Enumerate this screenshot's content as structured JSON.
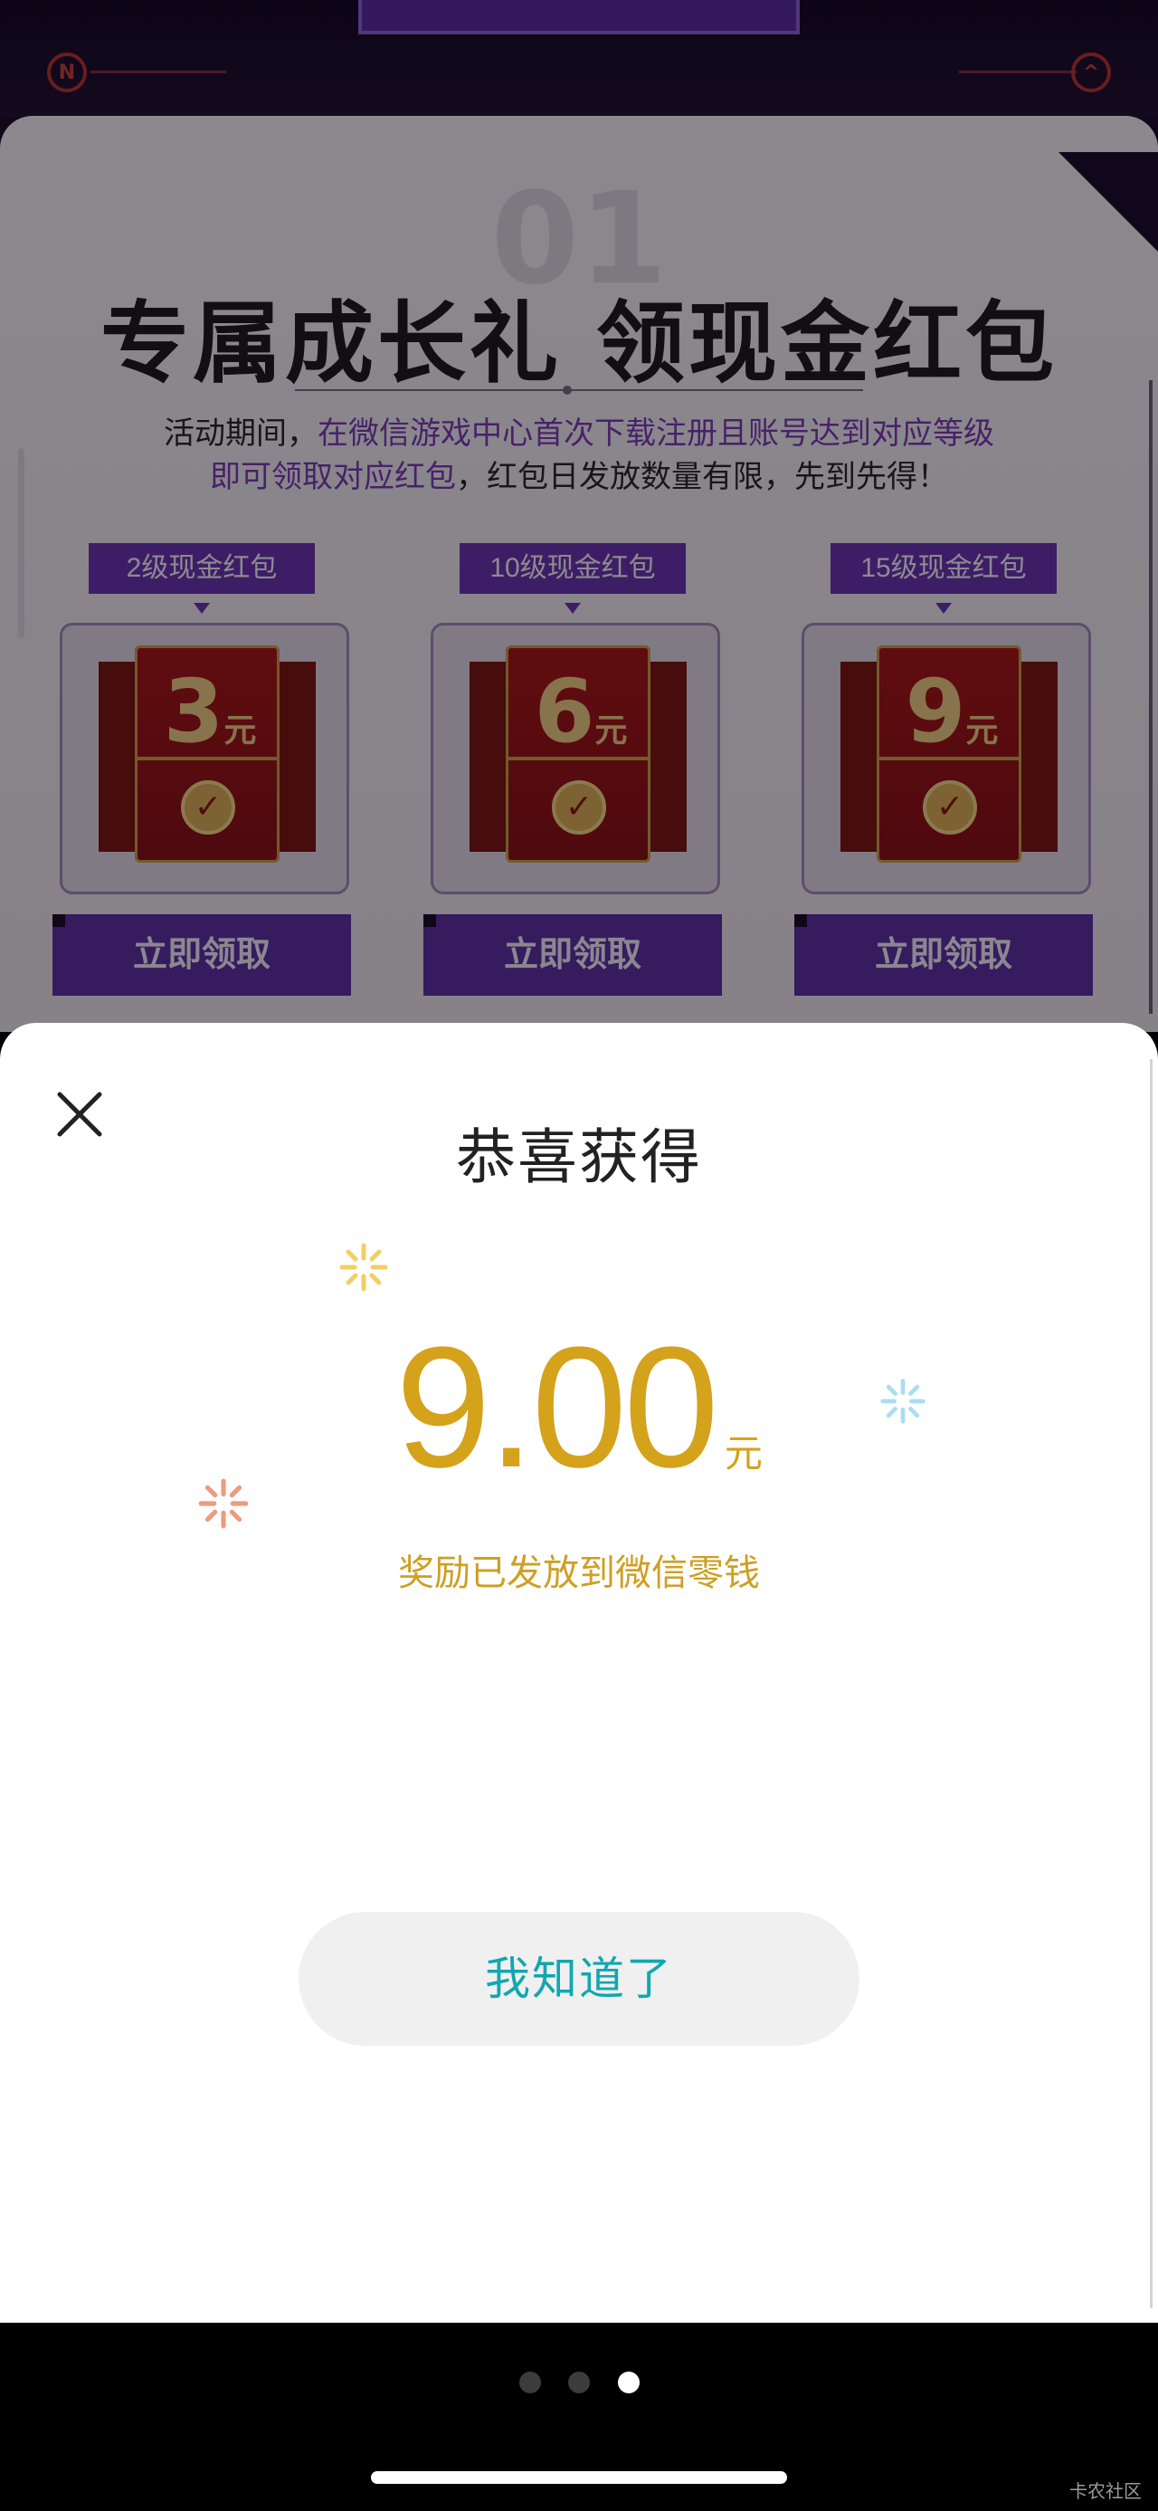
{
  "background_page": {
    "section_number": "01",
    "section_title": "专属成长礼 领现金红包",
    "description_line1_plain": "活动期间，",
    "description_line1_highlight": "在微信游戏中心首次下载注册且账号达到对应等级",
    "description_line2_highlight": "即可领取对应红包",
    "description_line2_plain": "，红包日发放数量有限，先到先得！",
    "corner_badges": [
      "N",
      "^"
    ],
    "rewards": [
      {
        "tag": "2级现金红包",
        "amount": "3",
        "unit": "元",
        "button": "立即领取"
      },
      {
        "tag": "10级现金红包",
        "amount": "6",
        "unit": "元",
        "button": "立即领取"
      },
      {
        "tag": "15级现金红包",
        "amount": "9",
        "unit": "元",
        "button": "立即领取"
      }
    ]
  },
  "dialog": {
    "title": "恭喜获得",
    "amount": "9.00",
    "unit": "元",
    "note": "奖励已发放到微信零钱",
    "confirm_button": "我知道了",
    "close_icon": "close-icon"
  },
  "pager": {
    "dots": 3,
    "active_index": 2
  },
  "watermark": "卡农社区",
  "colors": {
    "accent_purple": "#6a35b0",
    "gold": "#d4a21b",
    "teal": "#11a7b0"
  }
}
